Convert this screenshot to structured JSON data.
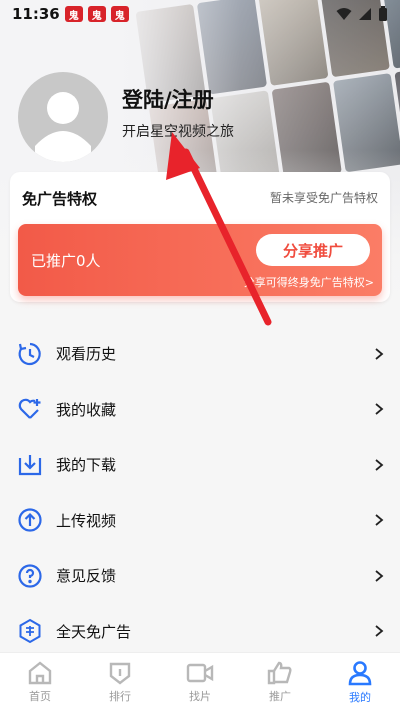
{
  "status_bar": {
    "time": "11:36",
    "notif_badge": "鬼"
  },
  "profile": {
    "title": "登陆/注册",
    "subtitle": "开启星空视频之旅"
  },
  "ad_free_card": {
    "title": "免广告特权",
    "status": "暂未享受免广告特权",
    "promo_count": "已推广0人",
    "share_button": "分享推广",
    "promo_hint": "分享可得终身免广告特权>"
  },
  "menu": {
    "items": [
      {
        "label": "观看历史",
        "icon": "history-icon"
      },
      {
        "label": "我的收藏",
        "icon": "heart-plus-icon"
      },
      {
        "label": "我的下载",
        "icon": "download-icon"
      },
      {
        "label": "上传视频",
        "icon": "upload-icon"
      },
      {
        "label": "意见反馈",
        "icon": "feedback-icon"
      },
      {
        "label": "全天免广告",
        "icon": "ad-free-icon"
      }
    ]
  },
  "bottom_nav": {
    "items": [
      {
        "label": "首页",
        "icon": "home-icon"
      },
      {
        "label": "排行",
        "icon": "ranking-icon"
      },
      {
        "label": "找片",
        "icon": "video-camera-icon"
      },
      {
        "label": "推广",
        "icon": "thumbs-up-icon"
      },
      {
        "label": "我的",
        "icon": "user-icon"
      }
    ],
    "active": "我的"
  },
  "colors": {
    "accent": "#2979ff",
    "promo": "#f25a48",
    "arrow": "#e8232b"
  }
}
